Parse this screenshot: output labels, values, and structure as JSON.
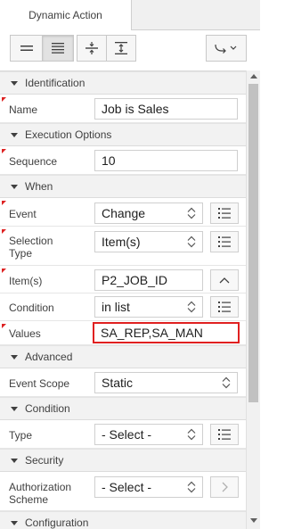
{
  "tab": {
    "label": "Dynamic Action"
  },
  "toolbar": {
    "buttons": [
      {
        "name": "collapse-all-icon"
      },
      {
        "name": "show-common-icon",
        "active": true
      },
      {
        "name": "collapse-groups-icon"
      },
      {
        "name": "expand-groups-icon"
      },
      {
        "name": "go-to-group-icon"
      }
    ]
  },
  "groups": {
    "identification": "Identification",
    "execution": "Execution Options",
    "when": "When",
    "advanced": "Advanced",
    "condition": "Condition",
    "security": "Security",
    "configuration": "Configuration"
  },
  "fields": {
    "name": {
      "label": "Name",
      "value": "Job is Sales"
    },
    "sequence": {
      "label": "Sequence",
      "value": "10"
    },
    "event": {
      "label": "Event",
      "value": "Change"
    },
    "selection_type": {
      "label": "Selection Type",
      "value": "Item(s)"
    },
    "items": {
      "label": "Item(s)",
      "value": "P2_JOB_ID"
    },
    "when_condition": {
      "label": "Condition",
      "value": "in list"
    },
    "values": {
      "label": "Values",
      "value": "SA_REP,SA_MAN"
    },
    "event_scope": {
      "label": "Event Scope",
      "value": "Static"
    },
    "cond_type": {
      "label": "Type",
      "value": "- Select -"
    },
    "auth_scheme": {
      "label": "Authorization Scheme",
      "value": "- Select -"
    }
  },
  "colors": {
    "highlight": "#e02020",
    "required": "#dd2222"
  }
}
